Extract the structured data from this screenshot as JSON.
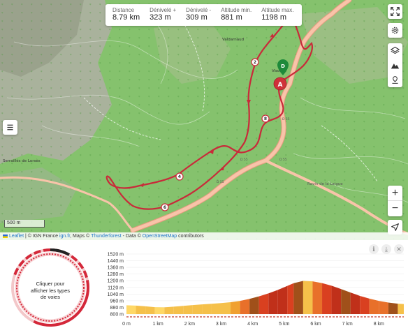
{
  "stats": [
    {
      "label": "Distance",
      "value": "8.79 km"
    },
    {
      "label": "Dénivelé +",
      "value": "323 m"
    },
    {
      "label": "Dénivelé -",
      "value": "309 m"
    },
    {
      "label": "Altitude min.",
      "value": "881 m"
    },
    {
      "label": "Altitude max.",
      "value": "1198 m"
    }
  ],
  "map": {
    "scale_label": "500 m",
    "place_labels": [
      "Valdarnaud",
      "Viso",
      "Serraillès de Lorsès",
      "Ravin de la Laigue"
    ],
    "road_labels": [
      "D 55",
      "D 55",
      "D 55",
      "D 55"
    ],
    "start_marker": "A",
    "end_marker": "D",
    "km_markers": [
      "2",
      "4",
      "6",
      "8"
    ],
    "attribution": {
      "leaflet": "Leaflet",
      "text1": " | © IGN France ",
      "ign_link": "ign.fr",
      "text2": ", Maps © ",
      "tf_link": "Thunderforest",
      "text3": " - Data © ",
      "osm_link": "OpenStreetMap",
      "text4": " contributors"
    }
  },
  "controls": {
    "fullscreen_icon": "fullscreen-icon",
    "settings_icon": "gear-icon",
    "layers_icon": "layers-icon",
    "relief_icon": "mountain-icon",
    "poi_icon": "marker-icon",
    "zoom_in": "+",
    "zoom_out": "−",
    "locate_icon": "locate-arrow-icon",
    "menu_icon": "menu-icon"
  },
  "panel": {
    "ring_text": "Cliquer pour afficher les types de voies",
    "info_icon": "ℹ",
    "download_icon": "⤓",
    "close_icon": "✕"
  },
  "chart_data": {
    "type": "area",
    "title": "",
    "xlabel": "",
    "ylabel": "",
    "y_ticks": [
      "1520 m",
      "1440 m",
      "1360 m",
      "1280 m",
      "1200 m",
      "1120 m",
      "1040 m",
      "960 m",
      "880 m",
      "800 m"
    ],
    "x_ticks": [
      "0 m",
      "1 km",
      "2 km",
      "3 km",
      "4 km",
      "5 km",
      "6 km",
      "7 km",
      "8 km"
    ],
    "ylim": [
      800,
      1520
    ],
    "xlim": [
      0,
      8.79
    ],
    "grid": true,
    "series": [
      {
        "x": [
          0,
          0.3,
          0.6,
          0.9,
          1.2,
          1.5,
          1.8,
          2.1,
          2.4,
          2.7,
          3.0,
          3.3,
          3.6,
          3.9,
          4.2,
          4.5,
          4.8,
          5.1,
          5.3,
          5.6,
          5.9,
          6.2,
          6.5,
          6.8,
          7.1,
          7.4,
          7.7,
          8.0,
          8.3,
          8.6,
          8.79
        ],
        "y": [
          906,
          902,
          893,
          883,
          881,
          889,
          898,
          908,
          916,
          924,
          932,
          942,
          958,
          982,
          1012,
          1048,
          1090,
          1138,
          1170,
          1198,
          1192,
          1172,
          1140,
          1100,
          1058,
          1018,
          985,
          958,
          938,
          925,
          920
        ]
      }
    ],
    "colors": {
      "fill_steps": [
        "#f5c04a",
        "#f0a030",
        "#e8702a",
        "#d94020",
        "#c0301a",
        "#a0501a",
        "#ffd866"
      ],
      "grade_line": "#c0392b"
    }
  }
}
